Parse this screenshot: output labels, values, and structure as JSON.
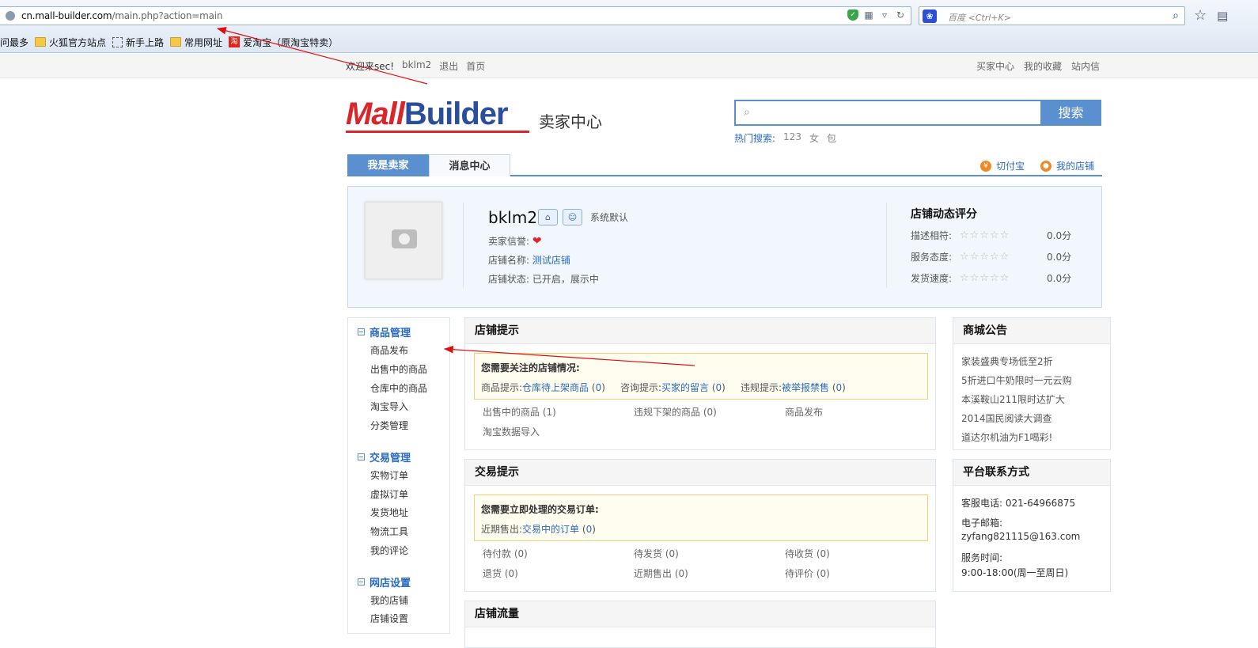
{
  "browser": {
    "url_host": "cn.mall-builder.com",
    "url_path": "/main.php?action=main",
    "search_placeholder": "百度 <Ctrl+K>",
    "bookmarks": [
      "访问最多",
      "火狐官方站点",
      "新手上路",
      "常用网址",
      "爱淘宝（原淘宝特卖）"
    ]
  },
  "topbar": {
    "welcome": "欢迎来sec!",
    "user": "bklm2",
    "logout": "退出",
    "home": "首页",
    "right_links": [
      "买家中心",
      "我的收藏",
      "站内信"
    ]
  },
  "header": {
    "logo_m": "M",
    "logo_all": "all",
    "logo_builder": "Builder",
    "subtitle": "卖家中心",
    "search_button": "搜索",
    "hot_label": "热门搜索:",
    "hot_terms": [
      "123",
      "女",
      "包"
    ]
  },
  "tabs": {
    "seller": "我是卖家",
    "messages": "消息中心",
    "right": [
      "切付宝",
      "我的店铺"
    ]
  },
  "profile": {
    "username": "bklm2",
    "system_default": "系统默认",
    "credit_label": "卖家信誉:",
    "shop_name_label": "店铺名称:",
    "shop_name": "测试店铺",
    "status_label": "店铺状态:",
    "status": "已开启，展示中",
    "rating_title": "店铺动态评分",
    "ratings": [
      {
        "label": "描述相符:",
        "value": "0.0分"
      },
      {
        "label": "服务态度:",
        "value": "0.0分"
      },
      {
        "label": "发货速度:",
        "value": "0.0分"
      }
    ]
  },
  "sidebar": {
    "groups": [
      {
        "title": "商品管理",
        "items": [
          "商品发布",
          "出售中的商品",
          "仓库中的商品",
          "淘宝导入",
          "分类管理"
        ]
      },
      {
        "title": "交易管理",
        "items": [
          "实物订单",
          "虚拟订单",
          "发货地址",
          "物流工具",
          "我的评论"
        ]
      },
      {
        "title": "网店设置",
        "items": [
          "我的店铺",
          "店铺设置"
        ]
      }
    ]
  },
  "store_tips": {
    "title": "店铺提示",
    "notice_title": "您需要关注的店铺情况:",
    "goods_label": "商品提示:",
    "goods_link": "仓库待上架商品",
    "goods_count": "0",
    "consult_label": "咨询提示:",
    "consult_link": "买家的留言",
    "consult_count": "0",
    "report_label": "违规提示:",
    "report_link": "被举报禁售",
    "report_count": "0",
    "links": [
      "出售中的商品 (1)",
      "违规下架的商品 (0)",
      "商品发布",
      "淘宝数据导入"
    ]
  },
  "trade_tips": {
    "title": "交易提示",
    "notice_title": "您需要立即处理的交易订单:",
    "recent_label": "近期售出:",
    "recent_link": "交易中的订单",
    "recent_count": "0",
    "links": [
      "待付款 (0)",
      "待发货 (0)",
      "待收货 (0)",
      "退货 (0)",
      "近期售出 (0)",
      "待评价 (0)"
    ]
  },
  "traffic": {
    "title": "店铺流量"
  },
  "announcements": {
    "title": "商城公告",
    "items": [
      "家装盛典专场低至2折",
      "5折进口牛奶限时一元云购",
      "本溪鞍山211限时达扩大",
      "2014国民阅读大调查",
      "道达尔机油为F1喝彩!"
    ]
  },
  "contact": {
    "title": "平台联系方式",
    "phone": "客服电话: 021-64966875",
    "email_label": "电子邮箱:",
    "email": "zyfang821115@163.com",
    "hours_label": "服务时间:",
    "hours": "9:00-18:00(周一至周日)"
  },
  "colors": {
    "brand_blue": "#5a8fd0",
    "link_blue": "#2a6bbf",
    "logo_red": "#d9262b",
    "arrow_red": "#e01010"
  }
}
